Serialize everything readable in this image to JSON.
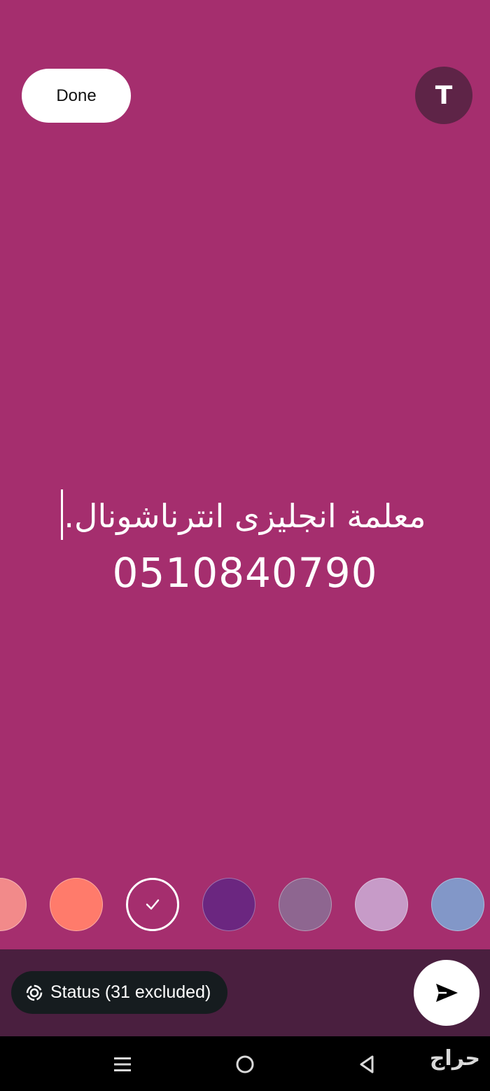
{
  "header": {
    "done_label": "Done",
    "font_button_label": "T"
  },
  "status_text": {
    "line1": "معلمة انجليزى انترناشونال.",
    "line2": "0510840790"
  },
  "background_color": "#a52e6e",
  "color_palette": {
    "selected_index": 2,
    "swatches": [
      {
        "color": "#f28a8a"
      },
      {
        "color": "#ff7b6b"
      },
      {
        "color": "#a52e6e"
      },
      {
        "color": "#6b2680"
      },
      {
        "color": "#8e6690"
      },
      {
        "color": "#c79bc8"
      },
      {
        "color": "#8297c8"
      }
    ]
  },
  "audience": {
    "label": "Status (31 excluded)",
    "icon": "status-ring-icon"
  },
  "send": {
    "icon": "send-arrow-icon"
  },
  "system_nav": {
    "recent_icon": "recent-apps-icon",
    "home_icon": "home-circle-icon",
    "back_icon": "back-triangle-icon"
  },
  "watermark_text": "حراج"
}
